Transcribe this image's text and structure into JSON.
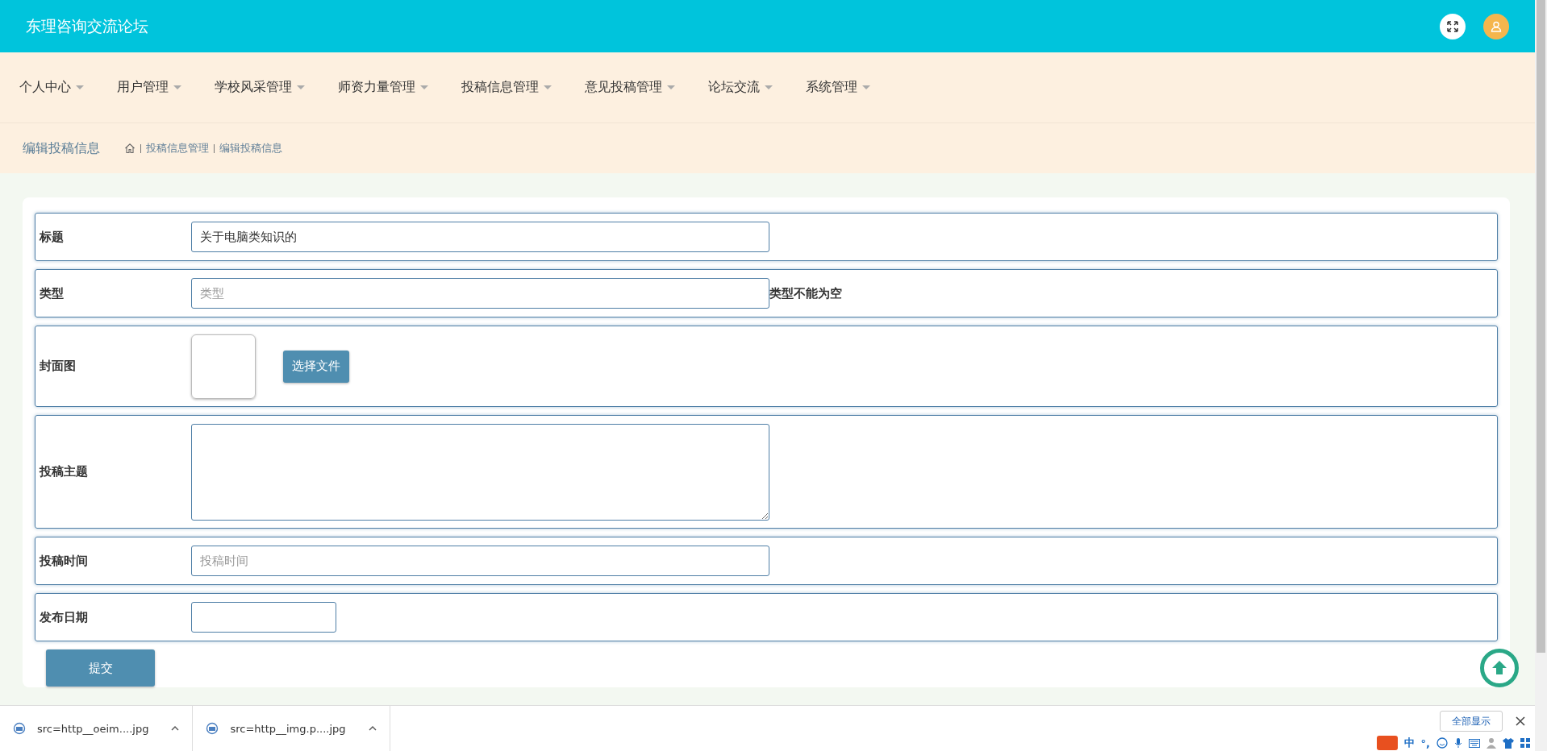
{
  "header": {
    "title": "东理咨询交流论坛"
  },
  "nav": [
    {
      "label": "个人中心"
    },
    {
      "label": "用户管理"
    },
    {
      "label": "学校风采管理"
    },
    {
      "label": "师资力量管理"
    },
    {
      "label": "投稿信息管理"
    },
    {
      "label": "意见投稿管理"
    },
    {
      "label": "论坛交流"
    },
    {
      "label": "系统管理"
    }
  ],
  "breadcrumb": {
    "title": "编辑投稿信息",
    "items": [
      "投稿信息管理",
      "编辑投稿信息"
    ]
  },
  "form": [
    {
      "kind": "text",
      "label": "标题",
      "value": "关于电脑类知识的"
    },
    {
      "kind": "text",
      "label": "类型",
      "placeholder": "类型",
      "error": "类型不能为空"
    },
    {
      "kind": "image",
      "label": "封面图",
      "button": "选择文件"
    },
    {
      "kind": "textarea",
      "label": "投稿主题"
    },
    {
      "kind": "text",
      "label": "投稿时间",
      "placeholder": "投稿时间"
    },
    {
      "kind": "date",
      "label": "发布日期"
    }
  ],
  "submit": "提交",
  "downloads": [
    {
      "name": "src=http__oeim....jpg"
    },
    {
      "name": "src=http__img.p....jpg"
    }
  ],
  "show_all": "全部显示",
  "ime": {
    "mode": "中",
    "punct": "°,"
  }
}
